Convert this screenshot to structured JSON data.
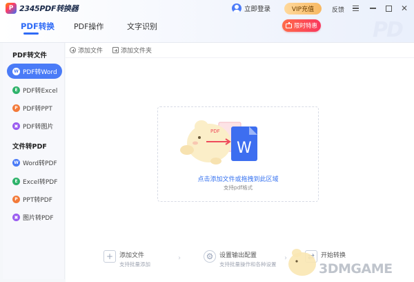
{
  "app": {
    "logo_mark": "P",
    "logo_text": "2345PDF转换器",
    "login_label": "立即登录",
    "vip_label": "VIP充值",
    "feedback_label": "反馈",
    "promo_label": "限时特惠",
    "watermark_pd": "PD"
  },
  "tabs": [
    {
      "label": "PDF转换",
      "active": true
    },
    {
      "label": "PDF操作",
      "active": false
    },
    {
      "label": "文字识别",
      "active": false
    }
  ],
  "sidebar": {
    "group1": "PDF转文件",
    "group2": "文件转PDF",
    "items": [
      {
        "label": "PDF转Word",
        "icon": "word-icon",
        "glyph": "W",
        "color": "#4a7bf7",
        "active": true
      },
      {
        "label": "PDF转Excel",
        "icon": "excel-icon",
        "glyph": "E",
        "color": "#2fb36b",
        "active": false
      },
      {
        "label": "PDF转PPT",
        "icon": "ppt-icon",
        "glyph": "P",
        "color": "#f37a3a",
        "active": false
      },
      {
        "label": "PDF转图片",
        "icon": "image-icon",
        "glyph": "▣",
        "color": "#9a5cf0",
        "active": false
      },
      {
        "label": "Word转PDF",
        "icon": "word-icon",
        "glyph": "W",
        "color": "#4a7bf7",
        "active": false
      },
      {
        "label": "Excel转PDF",
        "icon": "excel-icon",
        "glyph": "E",
        "color": "#2fb36b",
        "active": false
      },
      {
        "label": "PPT转PDF",
        "icon": "ppt-icon",
        "glyph": "P",
        "color": "#f37a3a",
        "active": false
      },
      {
        "label": "图片转PDF",
        "icon": "image-icon",
        "glyph": "▣",
        "color": "#9a5cf0",
        "active": false
      }
    ]
  },
  "toolbar": {
    "add_file": "添加文件",
    "add_folder": "添加文件夹"
  },
  "drop_zone": {
    "title": "点击添加文件或拖拽到此区域",
    "subtitle": "支持pdf格式",
    "illustration_badge": "PDF",
    "doc_glyph": "W"
  },
  "steps": [
    {
      "title": "添加文件",
      "subtitle": "支持批量添加",
      "icon": "add-file-icon"
    },
    {
      "title": "设置输出配置",
      "subtitle": "支持批量操作和各种设置",
      "icon": "settings-icon"
    },
    {
      "title": "开始转换",
      "subtitle": "",
      "icon": "convert-icon"
    }
  ],
  "watermark": "3DMGAME",
  "colors": {
    "accent": "#2f6bf6",
    "sidebar_active": "#4a7bf7",
    "vip": "#f7b862",
    "promo": "#f9375d"
  }
}
